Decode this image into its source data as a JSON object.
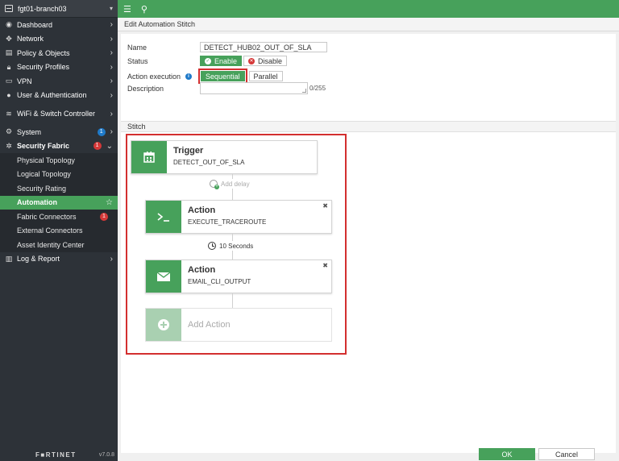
{
  "device": {
    "name": "fgt01-branch03"
  },
  "sidebar": {
    "items": [
      {
        "label": "Dashboard",
        "icon": "dashboard-icon"
      },
      {
        "label": "Network",
        "icon": "network-icon"
      },
      {
        "label": "Policy & Objects",
        "icon": "policy-icon"
      },
      {
        "label": "Security Profiles",
        "icon": "lock-icon"
      },
      {
        "label": "VPN",
        "icon": "vpn-icon"
      },
      {
        "label": "User & Authentication",
        "icon": "user-icon"
      },
      {
        "label": "WiFi & Switch Controller",
        "icon": "wifi-icon"
      },
      {
        "label": "System",
        "icon": "gear-icon",
        "badge": "1"
      },
      {
        "label": "Security Fabric",
        "icon": "fabric-icon",
        "badge": "1"
      }
    ],
    "fabric_sub": [
      {
        "label": "Physical Topology"
      },
      {
        "label": "Logical Topology"
      },
      {
        "label": "Security Rating"
      },
      {
        "label": "Automation"
      },
      {
        "label": "Fabric Connectors",
        "badge": "1"
      },
      {
        "label": "External Connectors"
      },
      {
        "label": "Asset Identity Center"
      }
    ],
    "log": {
      "label": "Log & Report",
      "icon": "log-icon"
    },
    "brand": "F■RTINET",
    "version": "v7.0.8"
  },
  "page": {
    "title": "Edit Automation Stitch"
  },
  "form": {
    "name_label": "Name",
    "name_value": "DETECT_HUB02_OUT_OF_SLA",
    "status_label": "Status",
    "enable_label": "Enable",
    "disable_label": "Disable",
    "exec_label": "Action execution",
    "sequential_label": "Sequential",
    "parallel_label": "Parallel",
    "desc_label": "Description",
    "desc_counter": "0/255"
  },
  "stitch": {
    "section_label": "Stitch",
    "trigger": {
      "title": "Trigger",
      "value": "DETECT_OUT_OF_SLA"
    },
    "add_delay": "Add delay",
    "action1": {
      "title": "Action",
      "value": "EXECUTE_TRACEROUTE"
    },
    "delay": "10 Seconds",
    "action2": {
      "title": "Action",
      "value": "EMAIL_CLI_OUTPUT"
    },
    "add_action": "Add Action"
  },
  "buttons": {
    "ok": "OK",
    "cancel": "Cancel"
  },
  "colors": {
    "accent": "#47a15b",
    "highlight": "#d32f2f",
    "sidebar": "#2d3238"
  }
}
